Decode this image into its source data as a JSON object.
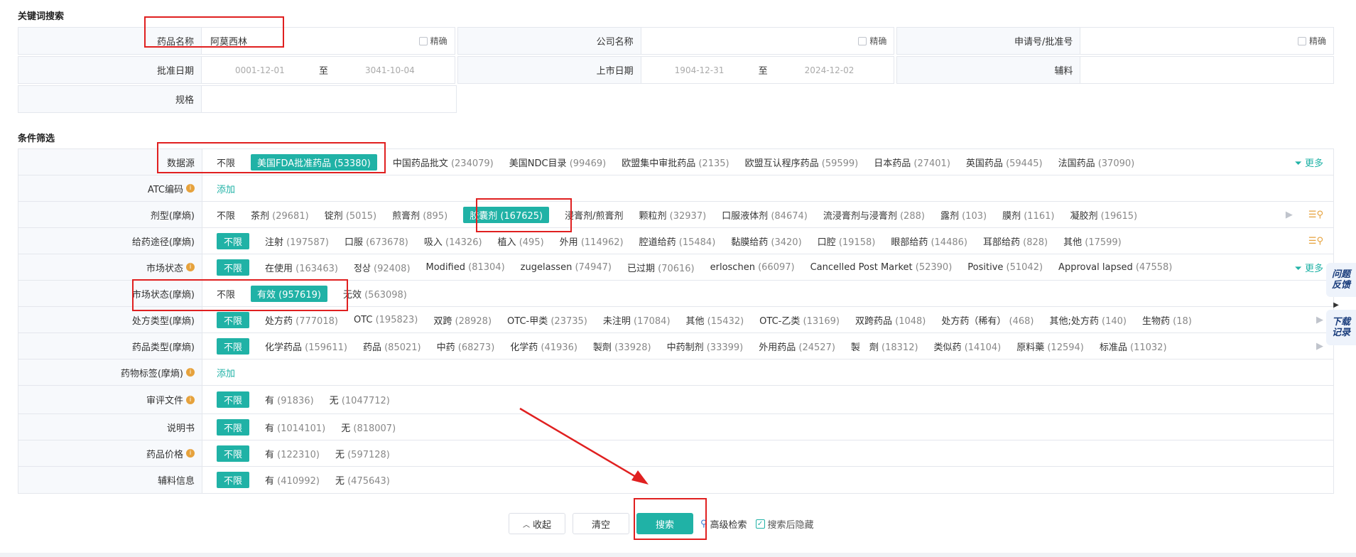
{
  "keyword_section": {
    "title": "关键词搜索"
  },
  "keyword": {
    "drug_name": {
      "label": "药品名称",
      "value": "阿莫西林",
      "exact": "精确"
    },
    "company": {
      "label": "公司名称",
      "value": "",
      "exact": "精确"
    },
    "app_no": {
      "label": "申请号/批准号",
      "value": "",
      "exact": "精确"
    },
    "approval_date": {
      "label": "批准日期",
      "from": "0001-12-01",
      "to_label": "至",
      "to": "3041-10-04"
    },
    "market_date": {
      "label": "上市日期",
      "from": "1904-12-31",
      "to_label": "至",
      "to": "2024-12-02"
    },
    "excipient": {
      "label": "辅料",
      "value": ""
    },
    "spec": {
      "label": "规格",
      "value": ""
    }
  },
  "filter_section": {
    "title": "条件筛选"
  },
  "filters": [
    {
      "label": "数据源",
      "info": false,
      "opts": [
        {
          "t": "不限",
          "c": ""
        },
        {
          "t": "美国FDA批准药品",
          "c": "(53380)",
          "sel": true
        },
        {
          "t": "中国药品批文",
          "c": "(234079)"
        },
        {
          "t": "美国NDC目录",
          "c": "(99469)"
        },
        {
          "t": "欧盟集中审批药品",
          "c": "(2135)"
        },
        {
          "t": "欧盟互认程序药品",
          "c": "(59599)"
        },
        {
          "t": "日本药品",
          "c": "(27401)"
        },
        {
          "t": "英国药品",
          "c": "(59445)"
        },
        {
          "t": "法国药品",
          "c": "(37090)"
        }
      ],
      "more": "更多"
    },
    {
      "label": "ATC编码",
      "info": true,
      "add": "添加"
    },
    {
      "label": "剂型(摩熵)",
      "info": false,
      "opts": [
        {
          "t": "不限",
          "c": ""
        },
        {
          "t": "茶剂",
          "c": "(29681)"
        },
        {
          "t": "锭剂",
          "c": "(5015)"
        },
        {
          "t": "煎膏剂",
          "c": "(895)"
        },
        {
          "t": "胶囊剂",
          "c": "(167625)",
          "sel": true
        },
        {
          "t": "浸膏剂/煎膏剂",
          "c": ""
        },
        {
          "t": "颗粒剂",
          "c": "(32937)"
        },
        {
          "t": "口服液体剂",
          "c": "(84674)"
        },
        {
          "t": "流浸膏剂与浸膏剂",
          "c": "(288)"
        },
        {
          "t": "露剂",
          "c": "(103)"
        },
        {
          "t": "膜剂",
          "c": "(1161)"
        },
        {
          "t": "凝胶剂",
          "c": "(19615)"
        }
      ],
      "side": "tri+search"
    },
    {
      "label": "给药途径(摩熵)",
      "info": false,
      "first": "不限",
      "opts": [
        {
          "t": "注射",
          "c": "(197587)"
        },
        {
          "t": "口服",
          "c": "(673678)"
        },
        {
          "t": "吸入",
          "c": "(14326)"
        },
        {
          "t": "植入",
          "c": "(495)"
        },
        {
          "t": "外用",
          "c": "(114962)"
        },
        {
          "t": "腔道给药",
          "c": "(15484)"
        },
        {
          "t": "黏膜给药",
          "c": "(3420)"
        },
        {
          "t": "口腔",
          "c": "(19158)"
        },
        {
          "t": "眼部给药",
          "c": "(14486)"
        },
        {
          "t": "耳部给药",
          "c": "(828)"
        },
        {
          "t": "其他",
          "c": "(17599)"
        }
      ],
      "side": "search"
    },
    {
      "label": "市场状态",
      "info": true,
      "first": "不限",
      "opts": [
        {
          "t": "在使用",
          "c": "(163463)"
        },
        {
          "t": "정상",
          "c": "(92408)"
        },
        {
          "t": "Modified",
          "c": "(81304)"
        },
        {
          "t": "zugelassen",
          "c": "(74947)"
        },
        {
          "t": "已过期",
          "c": "(70616)"
        },
        {
          "t": "erloschen",
          "c": "(66097)"
        },
        {
          "t": "Cancelled Post Market",
          "c": "(52390)"
        },
        {
          "t": "Positive",
          "c": "(51042)"
        },
        {
          "t": "Approval lapsed",
          "c": "(47558)"
        }
      ],
      "more": "更多"
    },
    {
      "label": "市场状态(摩熵)",
      "info": false,
      "opts": [
        {
          "t": "不限",
          "c": ""
        },
        {
          "t": "有效",
          "c": "(957619)",
          "sel": true
        },
        {
          "t": "无效",
          "c": "(563098)"
        }
      ]
    },
    {
      "label": "处方类型(摩熵)",
      "info": false,
      "first": "不限",
      "opts": [
        {
          "t": "处方药",
          "c": "(777018)"
        },
        {
          "t": "OTC",
          "c": "(195823)"
        },
        {
          "t": "双跨",
          "c": "(28928)"
        },
        {
          "t": "OTC-甲类",
          "c": "(23735)"
        },
        {
          "t": "未注明",
          "c": "(17084)"
        },
        {
          "t": "其他",
          "c": "(15432)"
        },
        {
          "t": "OTC-乙类",
          "c": "(13169)"
        },
        {
          "t": "双跨药品",
          "c": "(1048)"
        },
        {
          "t": "处方药（稀有）",
          "c": "(468)"
        },
        {
          "t": "其他;处方药",
          "c": "(140)"
        },
        {
          "t": "生物药",
          "c": "(18)"
        }
      ],
      "side": "tri"
    },
    {
      "label": "药品类型(摩熵)",
      "info": false,
      "first": "不限",
      "opts": [
        {
          "t": "化学药品",
          "c": "(159611)"
        },
        {
          "t": "药品",
          "c": "(85021)"
        },
        {
          "t": "中药",
          "c": "(68273)"
        },
        {
          "t": "化学药",
          "c": "(41936)"
        },
        {
          "t": "製劑",
          "c": "(33928)"
        },
        {
          "t": "中药制剂",
          "c": "(33399)"
        },
        {
          "t": "外用药品",
          "c": "(24527)"
        },
        {
          "t": "製　劑",
          "c": "(18312)"
        },
        {
          "t": "类似药",
          "c": "(14104)"
        },
        {
          "t": "原料藥",
          "c": "(12594)"
        },
        {
          "t": "标准品",
          "c": "(11032)"
        }
      ],
      "side": "tri"
    },
    {
      "label": "药物标签(摩熵)",
      "info": true,
      "add": "添加"
    },
    {
      "label": "审评文件",
      "info": true,
      "first": "不限",
      "opts": [
        {
          "t": "有",
          "c": "(91836)"
        },
        {
          "t": "无",
          "c": "(1047712)"
        }
      ]
    },
    {
      "label": "说明书",
      "info": false,
      "first": "不限",
      "opts": [
        {
          "t": "有",
          "c": "(1014101)"
        },
        {
          "t": "无",
          "c": "(818007)"
        }
      ]
    },
    {
      "label": "药品价格",
      "info": true,
      "first": "不限",
      "opts": [
        {
          "t": "有",
          "c": "(122310)"
        },
        {
          "t": "无",
          "c": "(597128)"
        }
      ]
    },
    {
      "label": "辅料信息",
      "info": false,
      "first": "不限",
      "opts": [
        {
          "t": "有",
          "c": "(410992)"
        },
        {
          "t": "无",
          "c": "(475643)"
        }
      ]
    }
  ],
  "buttons": {
    "collapse": "收起",
    "clear": "清空",
    "search": "搜索",
    "advanced": "高级检索",
    "hide_after": "搜索后隐藏"
  },
  "side_tabs": {
    "feedback": "问题反馈",
    "records": "下载记录"
  },
  "colors": {
    "accent": "#20b2a6",
    "highlight": "#e02020"
  }
}
